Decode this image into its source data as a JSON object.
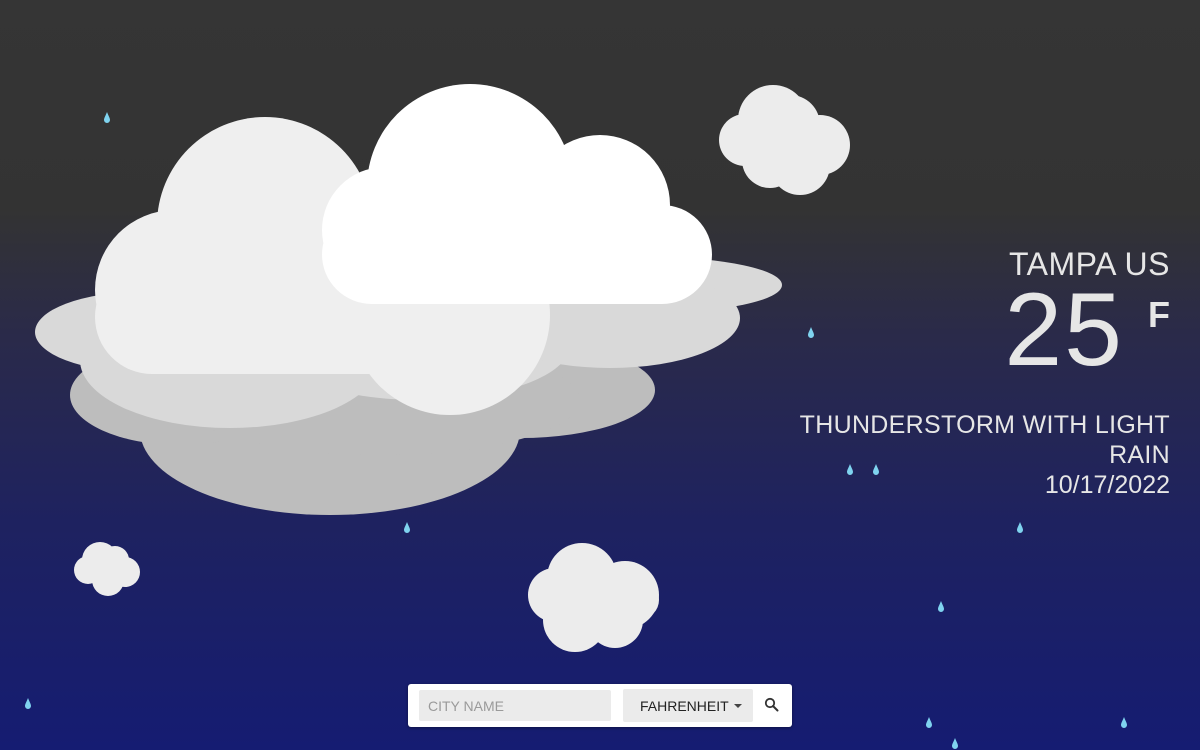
{
  "weather": {
    "location": "TAMPA US",
    "temperature": "25",
    "unit_symbol": "F",
    "description": "THUNDERSTORM WITH LIGHT RAIN",
    "date": "10/17/2022",
    "condition_icon": "storm-cloud-icon"
  },
  "search": {
    "placeholder": "CITY NAME",
    "value": "",
    "unit_selected": "FAHRENHEIT",
    "search_icon": "search-icon"
  },
  "colors": {
    "background_top": "#353535",
    "background_bottom": "#151c72",
    "text": "#e6e6e6",
    "raindrop": "#7fd3ef",
    "cloud_front": "#ffffff",
    "cloud_mid": "#e8e8e8",
    "cloud_back": "#bdbdbd"
  }
}
